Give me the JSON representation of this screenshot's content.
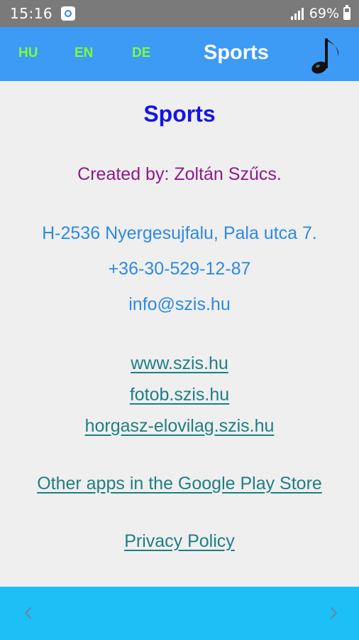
{
  "status_bar": {
    "time": "15:16",
    "battery_percent": "69%",
    "icons": [
      "camera-icon",
      "signal-icon",
      "battery-icon"
    ]
  },
  "header": {
    "languages": [
      "HU",
      "EN",
      "DE"
    ],
    "title": "Sports",
    "music_icon": "music-note-icon"
  },
  "main": {
    "title": "Sports",
    "author": "Created by: Zoltán Szűcs.",
    "address": "H-2536 Nyergesujfalu, Pala utca 7.",
    "phone": "+36-30-529-12-87",
    "email": "info@szis.hu",
    "websites": [
      "www.szis.hu",
      "fotob.szis.hu",
      "horgasz-elovilag.szis.hu"
    ],
    "store_link": "Other apps in the Google Play Store",
    "privacy_link": "Privacy Policy"
  },
  "footer": {
    "prev_icon": "chevron-left-icon",
    "next_icon": "chevron-right-icon"
  },
  "colors": {
    "status_bar": "#7a7a7a",
    "app_bar": "#3d9af5",
    "language_text": "#7cff3a",
    "page_title": "#1414e8",
    "author_text": "#8f1a8c",
    "contact_text": "#2e8ae0",
    "link_text": "#1f7e84",
    "bottom_bar": "#1cc0f7",
    "background": "#efefef"
  }
}
